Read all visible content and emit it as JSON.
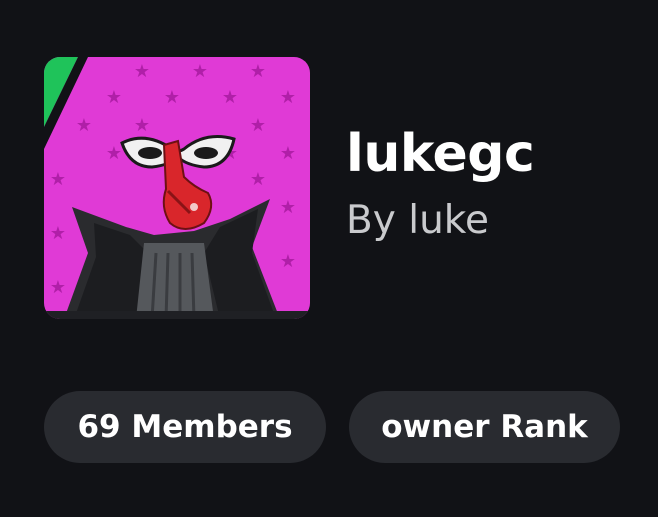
{
  "group": {
    "name": "lukegc",
    "owner_line": "By luke",
    "thumbnail_icon": "group-emblem-image"
  },
  "stats": {
    "members_label": "69 Members",
    "rank_label": "owner Rank"
  },
  "colors": {
    "background": "#111216",
    "pill_background": "#292b30",
    "title_text": "#ffffff",
    "subtitle_text": "#c9cacd",
    "emblem_pink": "#e03ad6",
    "emblem_green": "#1fc35a"
  }
}
